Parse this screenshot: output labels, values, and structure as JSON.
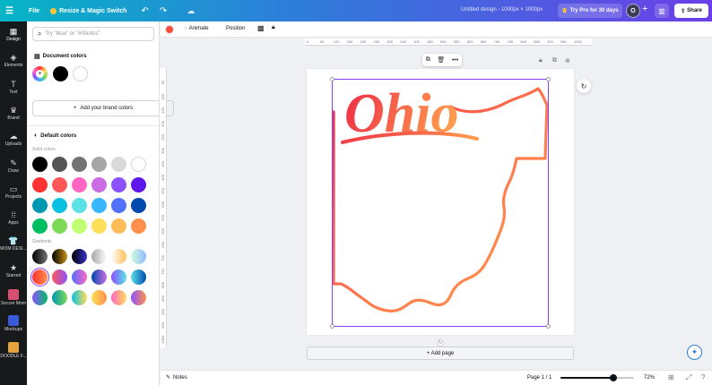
{
  "topbar": {
    "file": "File",
    "resize": "Resize & Magic Switch",
    "title": "Untitled design - 1000px × 1000px",
    "try_pro": "Try Pro for 30 days",
    "avatar": "O",
    "share": "Share"
  },
  "rail": [
    {
      "label": "Design",
      "icon": "design-icon",
      "glyph": "▦"
    },
    {
      "label": "Elements",
      "icon": "elements-icon",
      "glyph": "◈"
    },
    {
      "label": "Text",
      "icon": "text-icon",
      "glyph": "T"
    },
    {
      "label": "Brand",
      "icon": "brand-icon",
      "glyph": "♛"
    },
    {
      "label": "Uploads",
      "icon": "uploads-icon",
      "glyph": "☁"
    },
    {
      "label": "Draw",
      "icon": "draw-icon",
      "glyph": "✎"
    },
    {
      "label": "Projects",
      "icon": "projects-icon",
      "glyph": "▭"
    },
    {
      "label": "Apps",
      "icon": "apps-icon",
      "glyph": "⁞⁞"
    },
    {
      "label": "MOM DESI...",
      "icon": "mom-design-icon",
      "glyph": "👕"
    },
    {
      "label": "Starred",
      "icon": "star-icon",
      "glyph": "★"
    },
    {
      "label": "Soccer Mom",
      "icon": "soccer-mom-thumb",
      "glyph": ""
    },
    {
      "label": "Mockups",
      "icon": "mockups-thumb",
      "glyph": ""
    },
    {
      "label": "DOODLE F...",
      "icon": "doodle-thumb",
      "glyph": ""
    }
  ],
  "panel": {
    "search_placeholder": "Try \"blue\" or \"#00c4cc\"",
    "document_colors_title": "Document colors",
    "document_colors": [
      "#000000",
      "#ffffff"
    ],
    "add_brand_colors": "Add your brand colors",
    "default_colors_title": "Default colors",
    "solid_label": "Solid colors",
    "solid_colors": [
      "#000000",
      "#545454",
      "#737373",
      "#a6a6a6",
      "#d9d9d9",
      "#ffffff",
      "#ff3131",
      "#ff5757",
      "#ff66c4",
      "#cb6ce6",
      "#8c52ff",
      "#5e17eb",
      "#0097b2",
      "#0cc0df",
      "#5ce1e6",
      "#38b6ff",
      "#5271ff",
      "#004aad",
      "#00bf63",
      "#7ed957",
      "#c1ff72",
      "#ffde59",
      "#ffbd59",
      "#ff914d"
    ],
    "gradients_label": "Gradients",
    "gradients": [
      "linear-gradient(90deg,#000000,#737373)",
      "linear-gradient(90deg,#000000,#c89116)",
      "linear-gradient(90deg,#000000,#3533cd)",
      "linear-gradient(90deg,#a6a6a6,#ffffff)",
      "linear-gradient(90deg,#ffffff,#ffbd59)",
      "linear-gradient(90deg,#cdffd8,#94b9ff)",
      "linear-gradient(90deg,#ff3131,#ff914d)",
      "linear-gradient(90deg,#ff5757,#8c52ff)",
      "linear-gradient(90deg,#5170ff,#ff66c4)",
      "linear-gradient(90deg,#004aad,#cb6ce6)",
      "linear-gradient(90deg,#8c52ff,#5ce1e6)",
      "linear-gradient(90deg,#5de0e6,#004aad)",
      "linear-gradient(90deg,#8c52ff,#00bf63)",
      "linear-gradient(90deg,#0097b2,#7ed957)",
      "linear-gradient(90deg,#0cc0df,#ffde59)",
      "linear-gradient(90deg,#ffde59,#ff914d)",
      "linear-gradient(90deg,#ff66c4,#ffde59)",
      "linear-gradient(90deg,#8c52ff,#ff914d)"
    ]
  },
  "toolbar": {
    "animate": "Animate",
    "position": "Position",
    "fill_color": "#ff4d3a"
  },
  "ruler_top": [
    "0",
    "50",
    "100",
    "150",
    "200",
    "250",
    "300",
    "350",
    "400",
    "450",
    "500",
    "550",
    "600",
    "650",
    "700",
    "750",
    "800",
    "850",
    "900",
    "950",
    "1000"
  ],
  "ruler_left": [
    "50",
    "100",
    "150",
    "200",
    "250",
    "300",
    "350",
    "400",
    "450",
    "500",
    "550",
    "600",
    "650",
    "700",
    "750",
    "800",
    "850",
    "900",
    "950",
    "1000"
  ],
  "canvas": {
    "add_page": "+ Add page",
    "design_text": "Ohio",
    "gradient_start": "#ee2b47",
    "gradient_end": "#ff9a4d"
  },
  "bottombar": {
    "notes": "Notes",
    "page": "Page 1 / 1",
    "zoom": "72%",
    "zoom_percent": 72
  }
}
